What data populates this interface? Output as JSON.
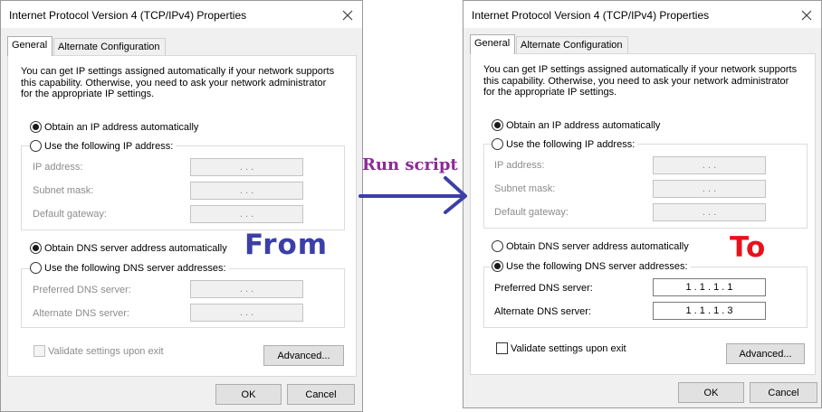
{
  "dialog_from": {
    "title": "Internet Protocol Version 4 (TCP/IPv4) Properties",
    "tabs": [
      "General",
      "Alternate Configuration"
    ],
    "description": [
      "You can get IP settings assigned automatically if your network supports",
      "this capability. Otherwise, you need to ask your network administrator",
      "for the appropriate IP settings."
    ],
    "ip_auto_label": "Obtain an IP address automatically",
    "ip_auto_checked": true,
    "ip_manual_label": "Use the following IP address:",
    "ip_address_label": "IP address:",
    "ip_address_value": ". . .",
    "subnet_label": "Subnet mask:",
    "subnet_value": ". . .",
    "gateway_label": "Default gateway:",
    "gateway_value": ". . .",
    "dns_auto_label": "Obtain DNS server address automatically",
    "dns_auto_checked": true,
    "dns_manual_label": "Use the following DNS server addresses:",
    "preferred_dns_label": "Preferred DNS server:",
    "preferred_dns_value": ". . .",
    "alternate_dns_label": "Alternate DNS server:",
    "alternate_dns_value": ". . .",
    "validate_label": "Validate settings upon exit",
    "advanced_label": "Advanced...",
    "ok_label": "OK",
    "cancel_label": "Cancel"
  },
  "dialog_to": {
    "title": "Internet Protocol Version 4 (TCP/IPv4) Properties",
    "tabs": [
      "General",
      "Alternate Configuration"
    ],
    "description": [
      "You can get IP settings assigned automatically if your network supports",
      "this capability. Otherwise, you need to ask your network administrator",
      "for the appropriate IP settings."
    ],
    "ip_auto_label": "Obtain an IP address automatically",
    "ip_auto_checked": true,
    "ip_manual_label": "Use the following IP address:",
    "ip_address_label": "IP address:",
    "ip_address_value": ". . .",
    "subnet_label": "Subnet mask:",
    "subnet_value": ". . .",
    "gateway_label": "Default gateway:",
    "gateway_value": ". . .",
    "dns_auto_label": "Obtain DNS server address automatically",
    "dns_manual_label": "Use the following DNS server addresses:",
    "dns_manual_checked": true,
    "preferred_dns_label": "Preferred DNS server:",
    "preferred_dns_value": "1 . 1 . 1 . 1",
    "alternate_dns_label": "Alternate DNS server:",
    "alternate_dns_value": "1 . 1 . 1 . 3",
    "validate_label": "Validate settings upon exit",
    "advanced_label": "Advanced...",
    "ok_label": "OK",
    "cancel_label": "Cancel"
  },
  "annotations": {
    "run_script": "Run script",
    "from": "From",
    "to": "To",
    "colors": {
      "run_script": "#8e2a97",
      "from": "#3b3fa6",
      "to": "#e8111c",
      "arrow": "#3b3fa6"
    }
  }
}
